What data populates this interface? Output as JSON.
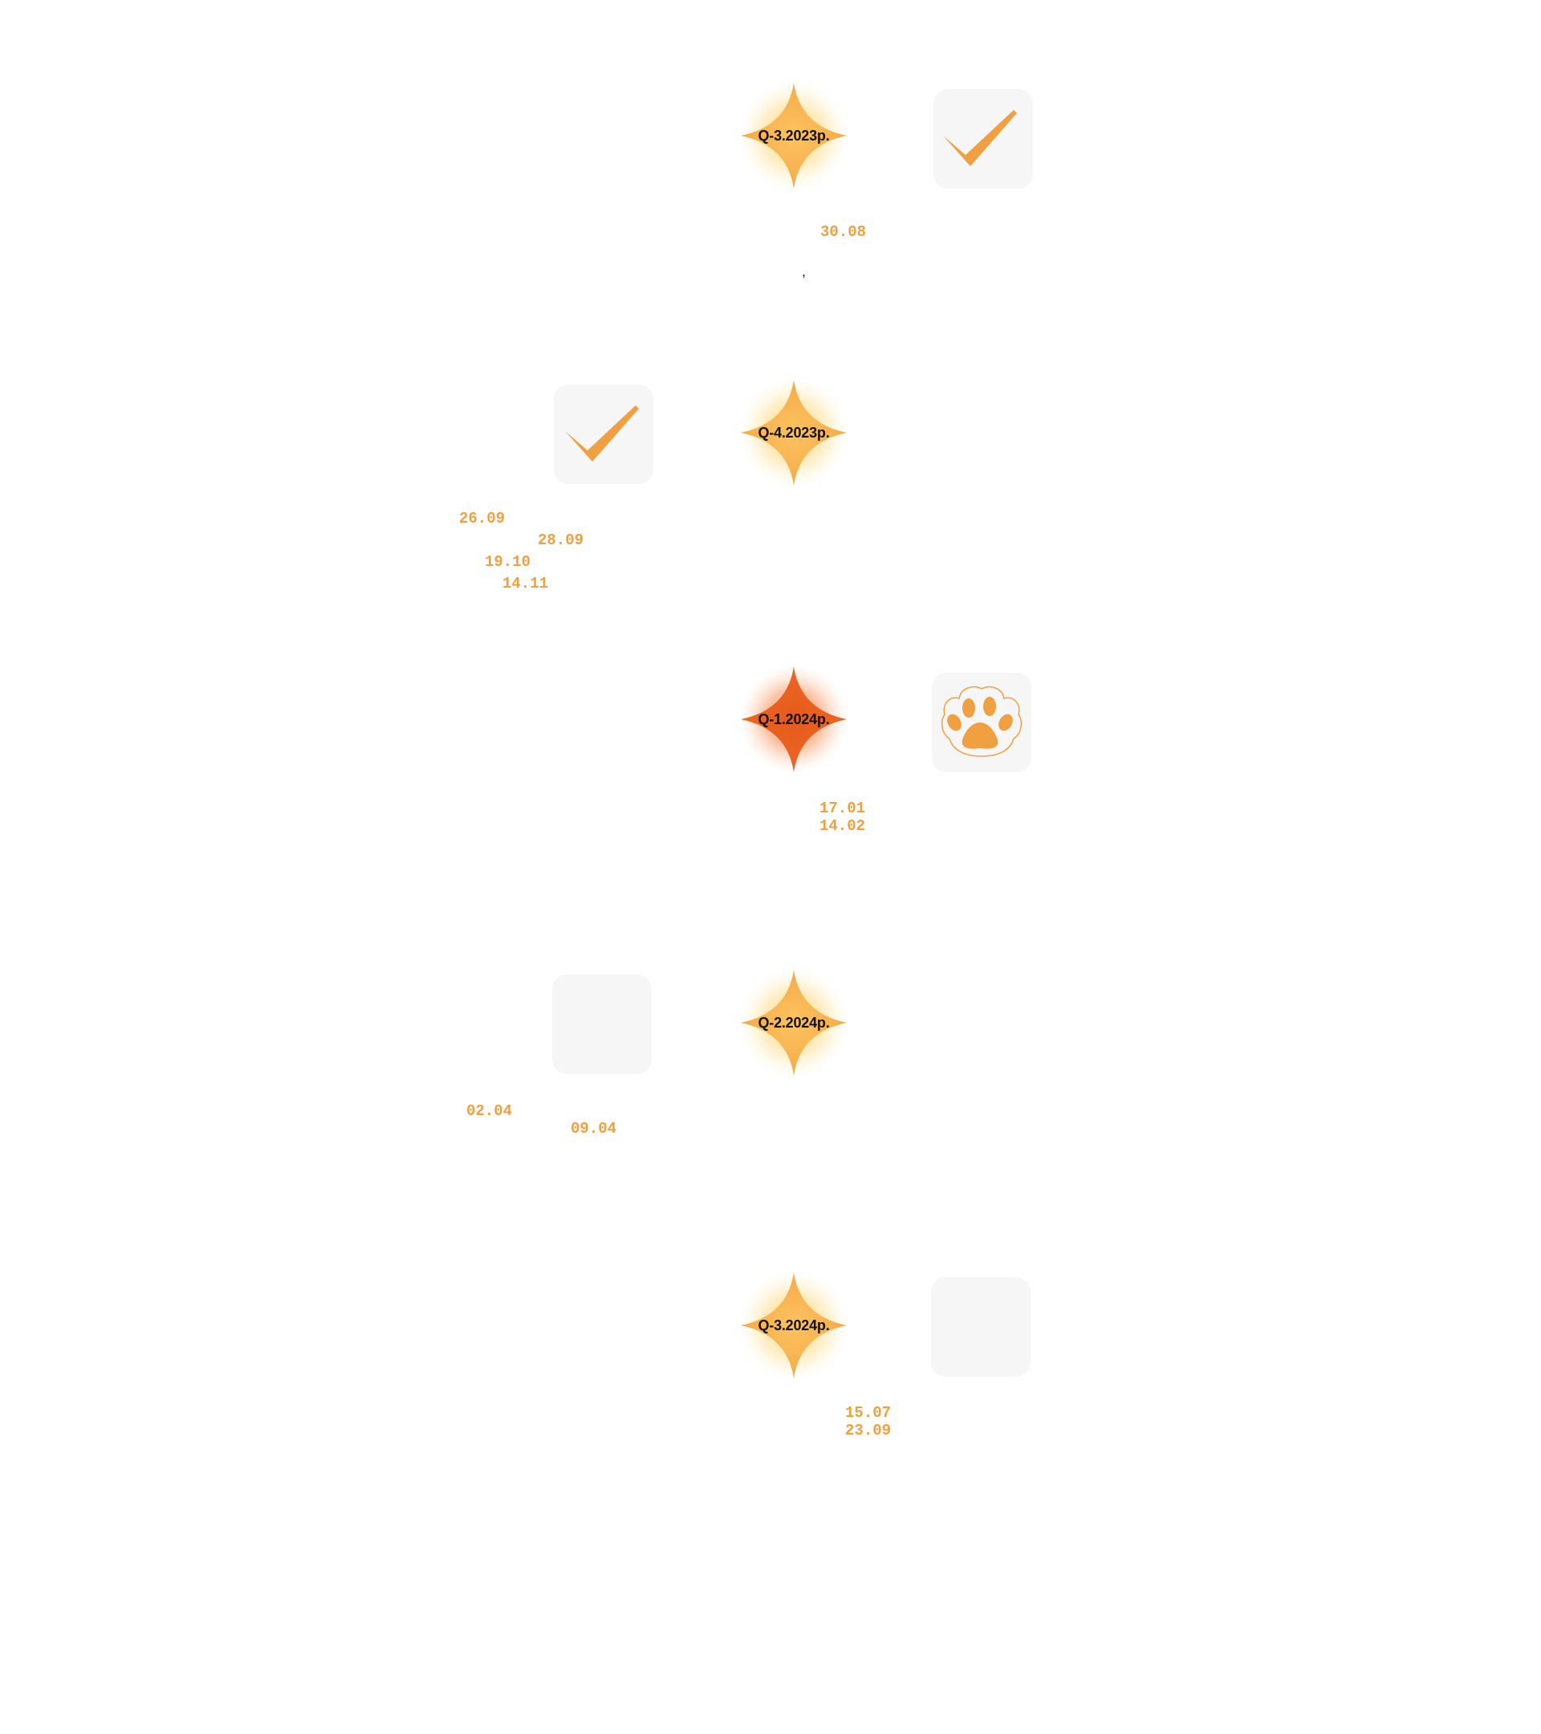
{
  "colors": {
    "accent": "#f0a040",
    "accent_dark": "#e85a1a",
    "tile_bg": "#f6f6f6",
    "label": "#111111"
  },
  "timeline": {
    "milestones": [
      {
        "label": "Q-3.2023р.",
        "tone": "gold",
        "tile_icon": "check-icon",
        "tile_side": "right",
        "dates": [
          "30.08"
        ]
      },
      {
        "label": "Q-4.2023р.",
        "tone": "gold",
        "tile_icon": "check-icon",
        "tile_side": "left",
        "dates": [
          "26.09",
          "28.09",
          "19.10",
          "14.11"
        ]
      },
      {
        "label": "Q-1.2024р.",
        "tone": "orange",
        "tile_icon": "paw-icon",
        "tile_side": "right",
        "dates": [
          "17.01",
          "14.02"
        ]
      },
      {
        "label": "Q-2.2024р.",
        "tone": "gold",
        "tile_icon": "",
        "tile_side": "left",
        "dates": [
          "02.04",
          "09.04"
        ]
      },
      {
        "label": "Q-3.2024р.",
        "tone": "gold",
        "tile_icon": "",
        "tile_side": "right",
        "dates": [
          "15.07",
          "23.09"
        ]
      }
    ],
    "separator": ","
  }
}
